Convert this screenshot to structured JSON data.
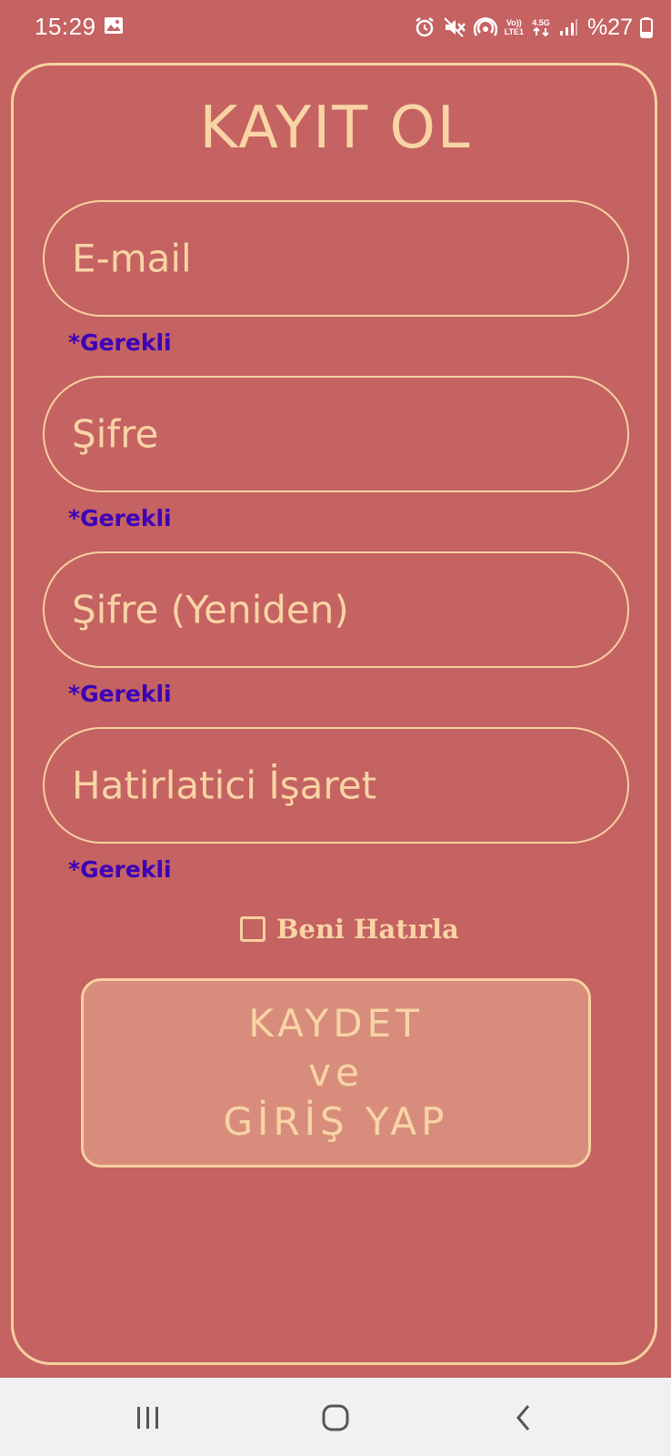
{
  "status_bar": {
    "time": "15:29",
    "icons": [
      "gallery-icon",
      "alarm-icon",
      "mute-icon",
      "hotspot-icon",
      "volte-icon",
      "4.5g-data-icon",
      "signal-icon",
      "battery-icon"
    ],
    "volte_label_top": "Vo))",
    "volte_label_bottom": "LTE1",
    "network_label": "4.5G",
    "battery_text": "%27"
  },
  "form": {
    "title": "KAYIT OL",
    "fields": [
      {
        "placeholder": "E-mail",
        "required_note": "*Gerekli"
      },
      {
        "placeholder": "Şifre",
        "required_note": "*Gerekli"
      },
      {
        "placeholder": "Şifre (Yeniden)",
        "required_note": "*Gerekli"
      },
      {
        "placeholder": "Hatirlatici İşaret",
        "required_note": "*Gerekli"
      }
    ],
    "remember_me": {
      "label": "Beni Hatırla",
      "checked": false
    },
    "submit_lines": [
      "KAYDET",
      "ve",
      "GİRİŞ YAP"
    ]
  },
  "nav_bar": {
    "buttons": [
      "recent-apps-icon",
      "home-icon",
      "back-icon"
    ]
  },
  "colors": {
    "background": "#C56262",
    "accent": "#F9D4A5",
    "required_text": "#3B00B8",
    "button_fill": "#D88D7C",
    "nav_bar": "#F1F1F1"
  }
}
